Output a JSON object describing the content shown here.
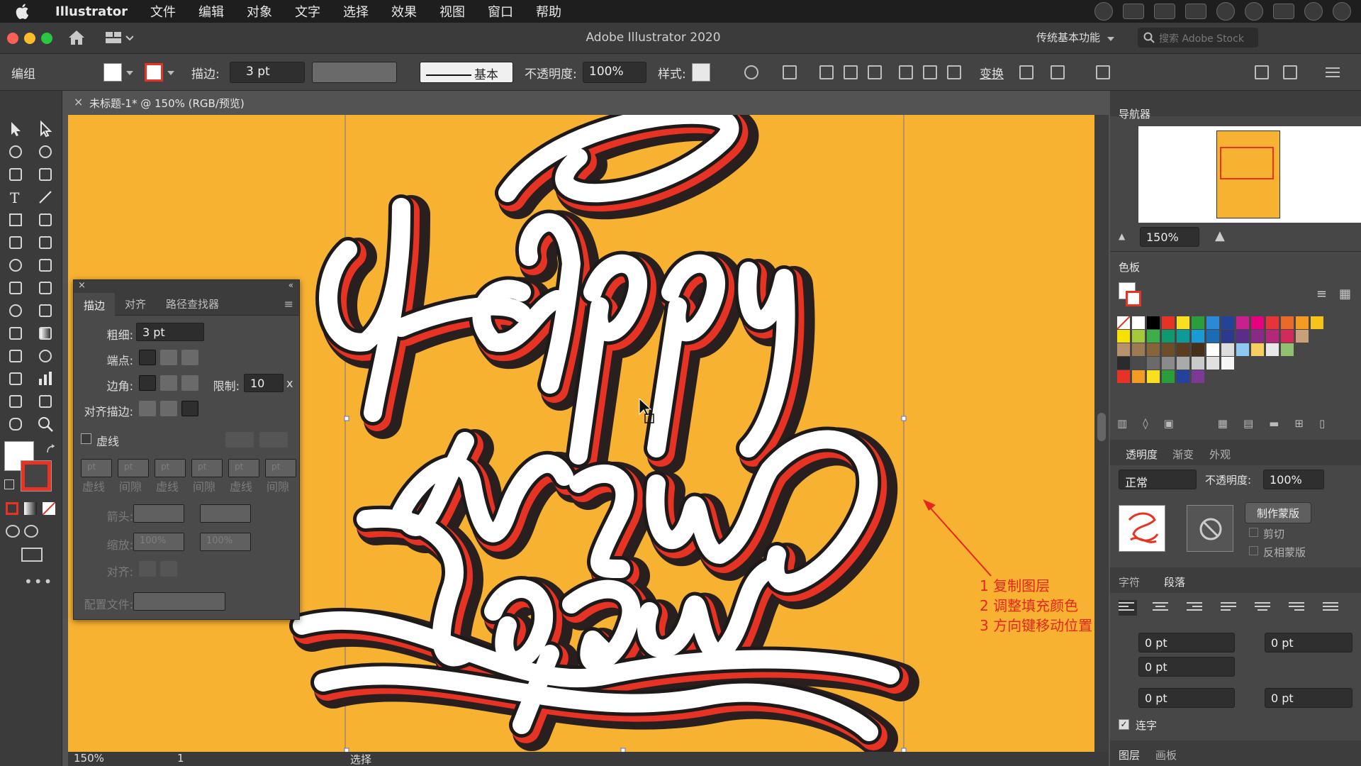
{
  "menubar": {
    "app_name": "Illustrator",
    "items": [
      "文件",
      "编辑",
      "对象",
      "文字",
      "选择",
      "效果",
      "视图",
      "窗口",
      "帮助"
    ]
  },
  "titlebar": {
    "title": "Adobe Illustrator 2020",
    "workspace": "传统基本功能",
    "search_placeholder": "搜索 Adobe Stock"
  },
  "controlbar": {
    "selection_label": "编组",
    "stroke_label": "描边:",
    "stroke_weight": "3 pt",
    "brush_label": "基本",
    "opacity_label": "不透明度:",
    "opacity_value": "100%",
    "style_label": "样式:",
    "transform_label": "变换"
  },
  "document": {
    "tab_label": "未标题-1* @ 150% (RGB/预览)",
    "zoom": "150%",
    "artboard_number": "1",
    "status_tool": "选择",
    "artwork_text": [
      "Happy",
      "New",
      "Year"
    ]
  },
  "stroke_panel": {
    "tabs": [
      "描边",
      "对齐",
      "路径查找器"
    ],
    "weight_label": "粗细:",
    "weight_value": "3 pt",
    "cap_label": "端点:",
    "corner_label": "边角:",
    "limit_label": "限制:",
    "limit_value": "10",
    "limit_unit": "x",
    "align_label": "对齐描边:",
    "dashed_label": "虚线",
    "dash_labels": [
      "虚线",
      "间隙",
      "虚线",
      "间隙",
      "虚线",
      "间隙"
    ],
    "dash_placeholder": "pt",
    "arrow_label": "箭头:",
    "scale_label": "缩放:",
    "scale_values": [
      "100%",
      "100%"
    ],
    "align2_label": "对齐:",
    "profile_label": "配置文件:"
  },
  "navigator": {
    "title": "导航器",
    "zoom": "150%"
  },
  "swatches": {
    "title": "色板",
    "rows": [
      [
        "none",
        "#ffffff",
        "#000000",
        "#e63323",
        "#f8e021",
        "#2a9e3a",
        "#2a8ad6",
        "#23429a",
        "#c8208c",
        "#e6007e",
        "#e6343a",
        "#eb6a2a",
        "#f39b22",
        "#f7c31b"
      ],
      [
        "#f5e200",
        "#a6c83b",
        "#3cae4a",
        "#0f9a6e",
        "#0f9a9a",
        "#199cd6",
        "#1b6cb4",
        "#2a3a8e",
        "#5a2d88",
        "#882a86",
        "#b4287a",
        "#d42a5a",
        "#c8a07a"
      ],
      [
        "#b8926a",
        "#9c7a52",
        "#86643c",
        "#6e4e2a",
        "#5a3c1e",
        "#46301a",
        "#ffffff",
        "#dddddd",
        "#8fc8f0",
        "#f5d060",
        "#e8e8e8",
        "#90c070"
      ],
      [
        "#2b2b2b",
        "#4a4a4a",
        "#6a6a6a",
        "#8a8a8a",
        "#aaaaaa",
        "#cacaca",
        "#e0e0e0",
        "#f5f5f5"
      ],
      [
        "#e63323",
        "#f39b22",
        "#f8e021",
        "#2a9e3a",
        "#23429a",
        "#7a3a96"
      ]
    ]
  },
  "transparency": {
    "tabs": [
      "透明度",
      "渐变",
      "外观"
    ],
    "blend_mode": "正常",
    "opacity_label": "不透明度:",
    "opacity_value": "100%",
    "make_mask_label": "制作蒙版",
    "clip_label": "剪切",
    "invert_label": "反相蒙版"
  },
  "paragraph": {
    "tabs": [
      "字符",
      "段落"
    ],
    "fields": [
      "0 pt",
      "0 pt",
      "0 pt",
      "0 pt",
      "0 pt"
    ],
    "hyphenate_label": "连字"
  },
  "bottom_tabs": [
    "图层",
    "画板"
  ],
  "annotation": {
    "lines": [
      "1 复制图层",
      "2 调整填充颜色",
      "3 方向键移动位置"
    ],
    "color": "#e8241e"
  },
  "colors": {
    "canvas_bg": "#f8b232",
    "stroke_red": "#e63323"
  }
}
